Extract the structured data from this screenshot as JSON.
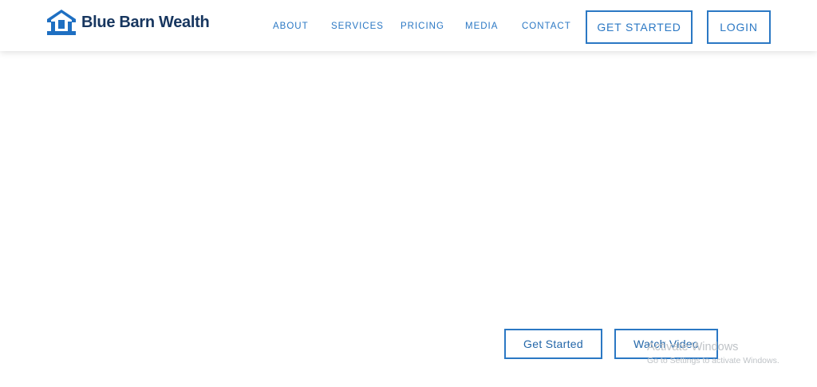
{
  "brand": {
    "name": "Blue Barn Wealth",
    "logo_icon": "barn-icon",
    "colors": {
      "primary_blue": "#2b78c4",
      "logo_blue": "#1e6fc2",
      "logo_text": "#17365f"
    }
  },
  "nav": {
    "items": [
      {
        "label": "ABOUT"
      },
      {
        "label": "SERVICES"
      },
      {
        "label": "PRICING"
      },
      {
        "label": "MEDIA"
      },
      {
        "label": "CONTACT"
      }
    ],
    "get_started_label": "GET STARTED",
    "login_label": "LOGIN"
  },
  "hero": {
    "get_started_label": "Get Started",
    "watch_video_label": "Watch Video"
  },
  "os_watermark": {
    "title": "Activate Windows",
    "subtitle": "Go to Settings to activate Windows."
  }
}
